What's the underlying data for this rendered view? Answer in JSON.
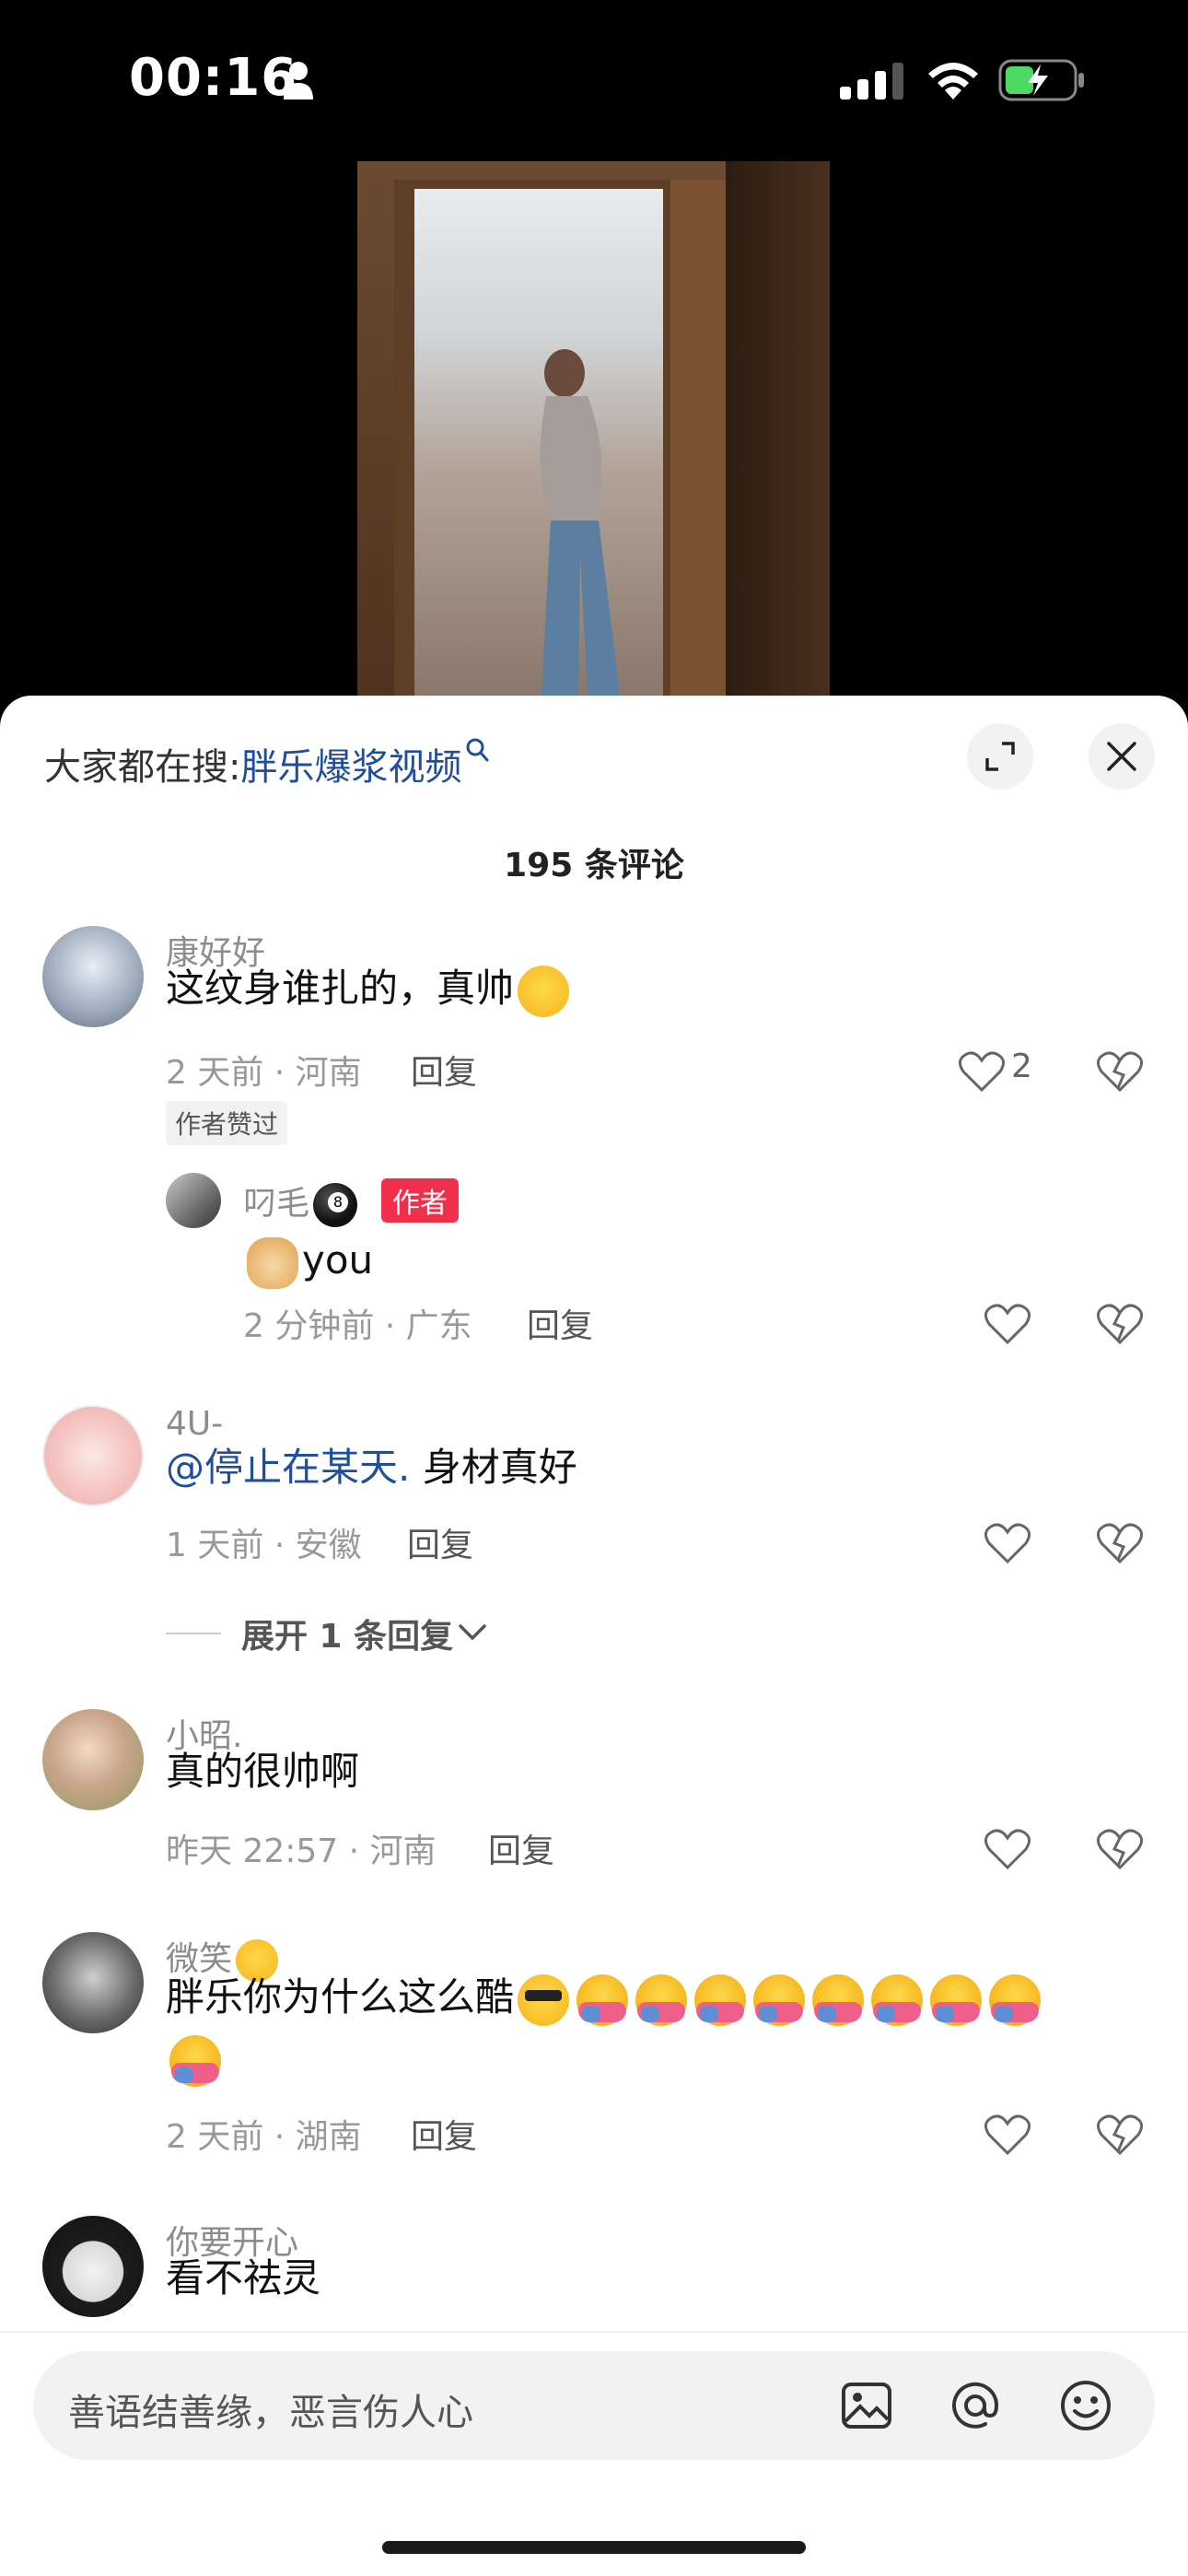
{
  "status_bar": {
    "time": "00:16"
  },
  "search_hint": {
    "label": "大家都在搜:",
    "keyword": "胖乐爆浆视频"
  },
  "comment_count": "195 条评论",
  "comments": [
    {
      "user": "康好好",
      "text": "这纹身谁扎的，真帅",
      "meta": "2 天前 · 河南",
      "reply_label": "回复",
      "likes": "2",
      "author_liked": "作者赞过",
      "reply": {
        "user": "叼毛",
        "badge": "作者",
        "text": "you",
        "meta": "2 分钟前 · 广东",
        "reply_label": "回复"
      }
    },
    {
      "user": "4U-",
      "mention": "@停止在某天.",
      "text": " 身材真好",
      "meta": "1 天前 · 安徽",
      "reply_label": "回复"
    },
    {
      "user": "小昭.",
      "text": "真的很帅啊",
      "meta": "昨天 22:57 · 河南",
      "reply_label": "回复"
    },
    {
      "user": "微笑",
      "text": "胖乐你为什么这么酷",
      "meta": "2 天前 · 湖南",
      "reply_label": "回复"
    },
    {
      "user": "你要开心",
      "text": "看不祛灵"
    }
  ],
  "expand_replies": "展开 1 条回复",
  "input": {
    "placeholder": "善语结善缘，恶言伤人心"
  },
  "colors": {
    "link": "#1f4e9c",
    "author_badge": "#f0304b",
    "sheet": "#ffffff"
  }
}
